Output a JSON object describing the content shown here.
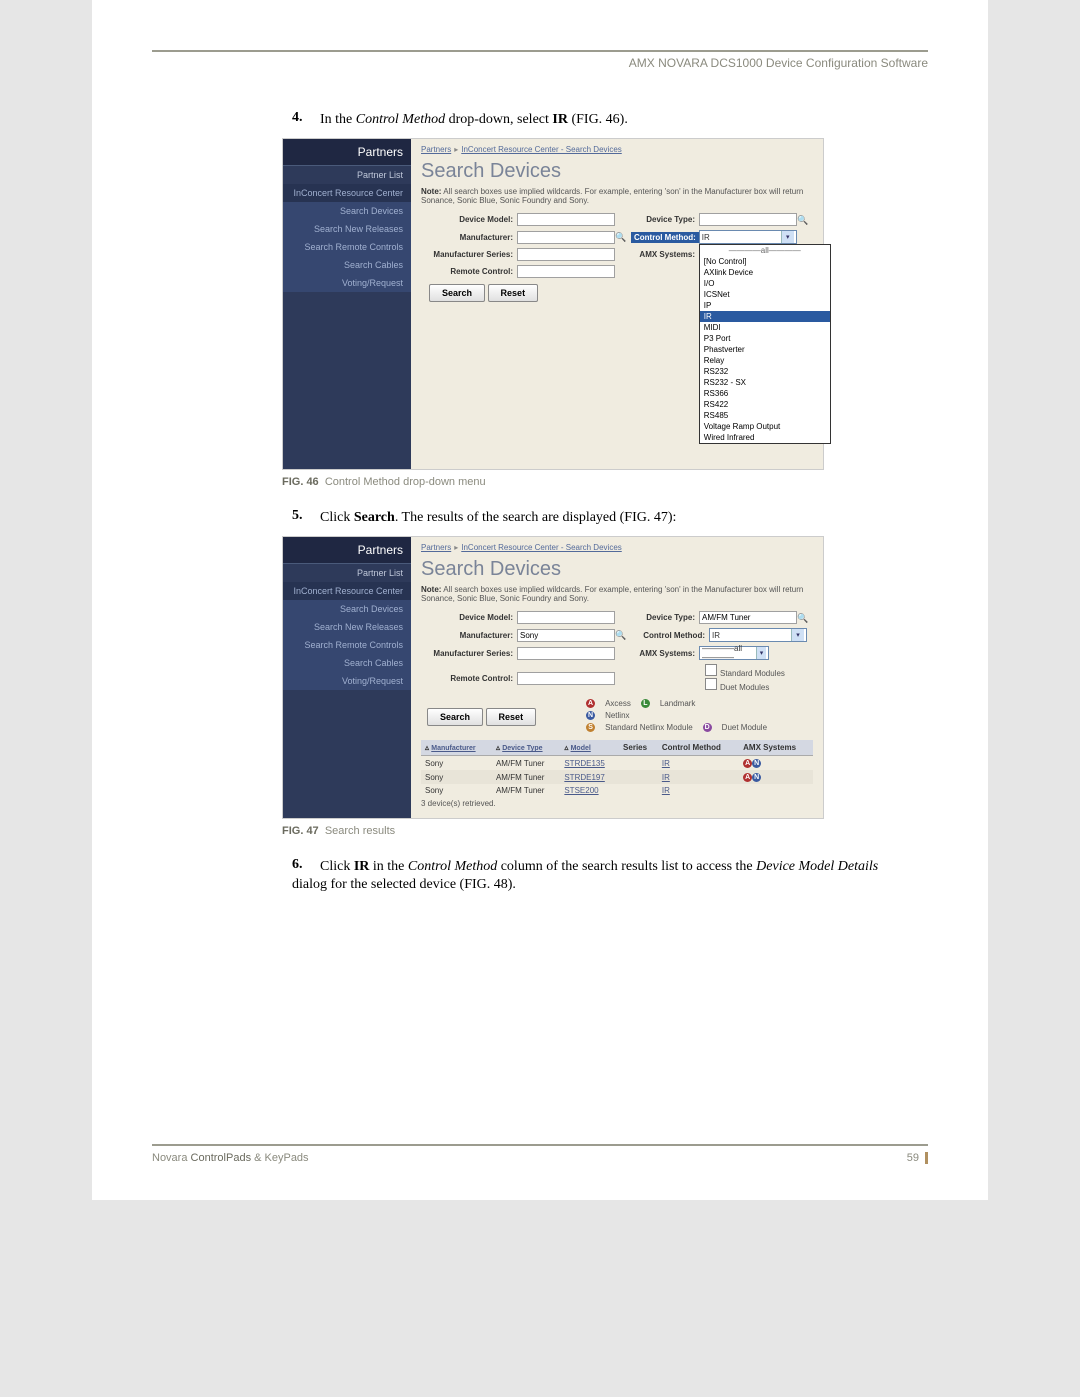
{
  "header": "AMX NOVARA DCS1000 Device Configuration Software",
  "step4": {
    "num": "4.",
    "text_a": "In the ",
    "em": "Control Method",
    "text_b": " drop-down, select ",
    "strong": "IR",
    "text_c": " (FIG. 46)."
  },
  "step5": {
    "num": "5.",
    "text_a": "Click ",
    "strong": "Search",
    "text_b": ". The results of the search are displayed (FIG. 47):"
  },
  "step6": {
    "num": "6.",
    "text_a": "Click ",
    "strong": "IR",
    "text_b": " in the ",
    "em1": "Control Method",
    "text_c": " column of the search results list to access the ",
    "em2": "Device Model Details",
    "text_d": " dialog for the selected device (FIG. 48)."
  },
  "fig46": {
    "label": "FIG. 46",
    "caption": "Control Method drop-down menu"
  },
  "fig47": {
    "label": "FIG. 47",
    "caption": "Search results"
  },
  "sidebar": {
    "header": "Partners",
    "items": [
      "Partner List",
      "InConcert Resource Center",
      "Search Devices",
      "Search New Releases",
      "Search Remote Controls",
      "Search Cables",
      "Voting/Request"
    ]
  },
  "breadcrumb": {
    "a": "Partners",
    "b": "InConcert Resource Center - Search Devices"
  },
  "search_page": {
    "title": "Search Devices",
    "note_strong": "Note:",
    "note": " All search boxes use implied wildcards. For example, entering 'son' in the Manufacturer box will return Sonance, Sonic Blue, Sonic Foundry and Sony.",
    "labels": {
      "device_model": "Device Model:",
      "device_type": "Device Type:",
      "manufacturer": "Manufacturer:",
      "control_method": "Control Method:",
      "mfr_series": "Manufacturer Series:",
      "amx_systems": "AMX Systems:",
      "remote_control": "Remote Control:"
    },
    "buttons": {
      "search": "Search",
      "reset": "Reset"
    },
    "control_method_value": "IR",
    "dd_options": [
      "————all————",
      "[No Control]",
      "AXlink Device",
      "I/O",
      "ICSNet",
      "IP",
      "IR",
      "MIDI",
      "P3 Port",
      "Phastverter",
      "Relay",
      "RS232",
      "RS232 - SX",
      "RS366",
      "RS422",
      "RS485",
      "Voltage Ramp Output",
      "Wired Infrared"
    ]
  },
  "search_page2": {
    "device_type_value": "AM/FM Tuner",
    "manufacturer_value": "Sony",
    "control_method_value": "IR",
    "amx_value": "————all————",
    "checks": {
      "std": "Standard Modules",
      "duet": "Duet Modules"
    },
    "legend": {
      "axcess": "Axcess",
      "landmark": "Landmark",
      "netlinx": "Netlinx",
      "stdnet": "Standard Netlinx Module",
      "duetmod": "Duet Module"
    },
    "table": {
      "headers": [
        "Manufacturer",
        "Device Type",
        "Model",
        "Series",
        "Control Method",
        "AMX Systems"
      ],
      "rows": [
        {
          "mfr": "Sony",
          "type": "AM/FM Tuner",
          "model": "STRDE135",
          "series": "",
          "cm": "IR"
        },
        {
          "mfr": "Sony",
          "type": "AM/FM Tuner",
          "model": "STRDE197",
          "series": "",
          "cm": "IR"
        },
        {
          "mfr": "Sony",
          "type": "AM/FM Tuner",
          "model": "STSE200",
          "series": "",
          "cm": "IR"
        }
      ],
      "retrieved": "3 device(s) retrieved."
    }
  },
  "footer": {
    "left_a": "Novara ",
    "left_b": "ControlPads",
    "left_c": "   &  KeyPads",
    "page": "59"
  }
}
